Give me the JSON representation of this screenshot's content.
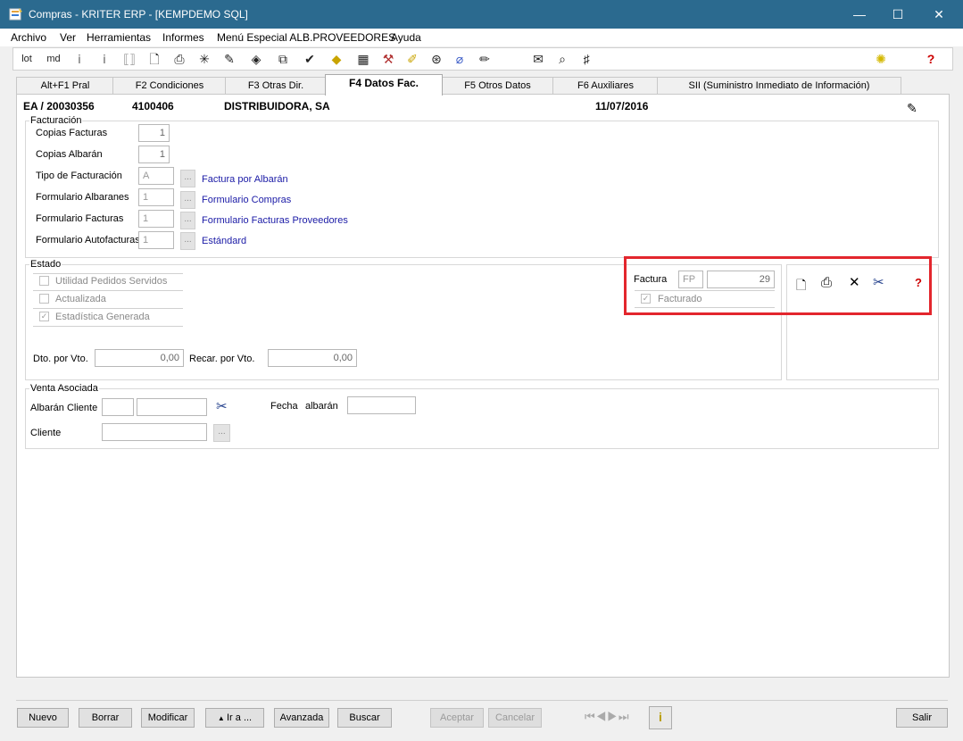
{
  "window": {
    "title": "Compras - KRITER ERP - [KEMPDEMO SQL]",
    "minimize": "—",
    "maximize": "☐",
    "close": "✕"
  },
  "menu": [
    "Archivo",
    "Ver",
    "Herramientas",
    "Informes",
    "Menú Especial ALB.PROVEEDORES",
    "Ayuda"
  ],
  "toolbar": {
    "lot_label": "lot",
    "md_label": "md",
    "icons": [
      "info-icon",
      "info-grey-icon",
      "bracket-icon",
      "preview-icon",
      "print-icon",
      "sparkle-icon",
      "fileedit-icon",
      "diamond-icon",
      "link-icon",
      "check-icon",
      "warning-icon",
      "grid-icon",
      "tools-icon",
      "pen-icon",
      "disk-icon",
      "attach-icon",
      "clip-icon",
      "note-icon",
      "search-doc-icon",
      "hash-icon",
      "bulb-icon",
      "help-icon"
    ]
  },
  "tabs": [
    {
      "label": "Alt+F1 Pral"
    },
    {
      "label": "F2 Condiciones"
    },
    {
      "label": "F3 Otras Dir."
    },
    {
      "label": "F4 Datos Fac."
    },
    {
      "label": "F5 Otros Datos"
    },
    {
      "label": "F6 Auxiliares"
    },
    {
      "label": "SII (Suministro Inmediato de Información)"
    }
  ],
  "header": {
    "doc": "EA / 20030356",
    "code": "4100406",
    "name": "DISTRIBUIDORA, SA",
    "date": "11/07/2016"
  },
  "facturacion": {
    "title": "Facturación",
    "copias_facturas": {
      "label": "Copias Facturas",
      "value": "1"
    },
    "copias_albaran": {
      "label": "Copias Albarán",
      "value": "1"
    },
    "tipo": {
      "label": "Tipo de Facturación",
      "value": "A",
      "desc": "Factura por Albarán"
    },
    "form_albaranes": {
      "label": "Formulario Albaranes",
      "value": "1",
      "desc": "Formulario Compras"
    },
    "form_facturas": {
      "label": "Formulario Facturas",
      "value": "1",
      "desc": "Formulario Facturas Proveedores"
    },
    "form_autofacturas": {
      "label": "Formulario Autofacturas",
      "value": "1",
      "desc": "Estándard"
    },
    "ellipsis": "..."
  },
  "estado": {
    "title": "Estado",
    "checks": [
      {
        "label": "Utilidad Pedidos Servidos",
        "checked": false
      },
      {
        "label": "Actualizada",
        "checked": false
      },
      {
        "label": "Estadística Generada",
        "checked": true
      }
    ],
    "dto_label": "Dto. por Vto.",
    "dto_value": "0,00",
    "recar_label": "Recar. por Vto.",
    "recar_value": "0,00",
    "factura_label": "Factura",
    "factura_serie": "FP",
    "factura_num": "29",
    "facturado_label": "Facturado",
    "facturado_checked": true
  },
  "venta": {
    "title": "Venta Asociada",
    "albaran_label": "Albarán Cliente",
    "fecha_label": "Fecha",
    "albaran2_label": "albarán",
    "cliente_label": "Cliente",
    "ellipsis": "..."
  },
  "buttons": {
    "nuevo": "Nuevo",
    "borrar": "Borrar",
    "modificar": "Modificar",
    "ira": "Ir a ...",
    "avanzada": "Avanzada",
    "buscar": "Buscar",
    "aceptar": "Aceptar",
    "cancelar": "Cancelar",
    "salir": "Salir"
  },
  "colors": {
    "titlebar": "#2b6a8f",
    "highlight": "#e3262d",
    "link": "#1a1aa6"
  }
}
